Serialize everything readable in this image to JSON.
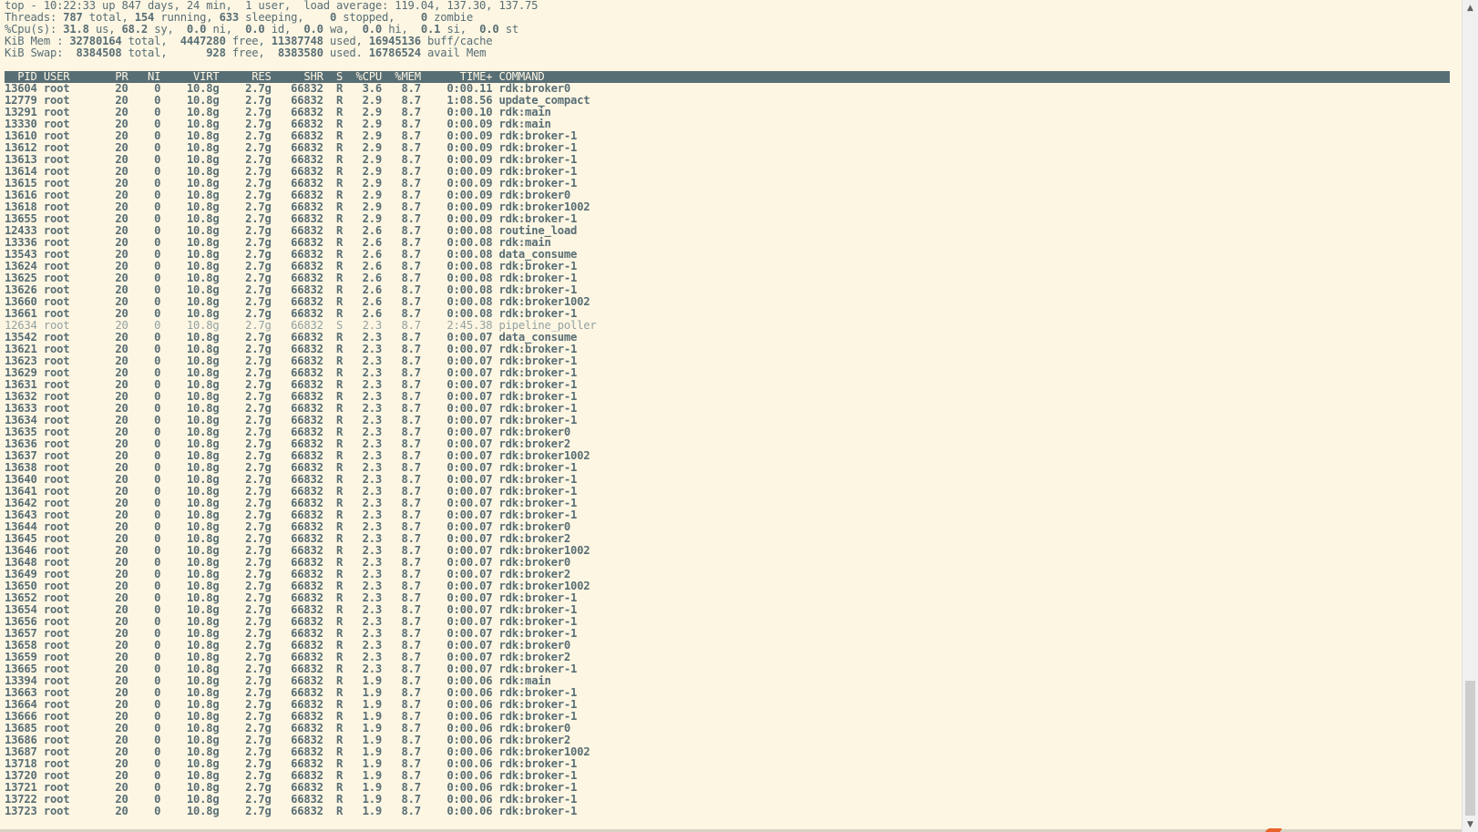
{
  "summary": {
    "line1": "top - 10:22:33 up 847 days, 24 min,  1 user,  load average: 119.04, 137.30, 137.75",
    "threads": {
      "total": "787",
      "running": "154",
      "sleeping": "633",
      "stopped": "0",
      "zombie": "0"
    },
    "cpu": {
      "us": "31.8",
      "sy": "68.2",
      "ni": "0.0",
      "id": "0.0",
      "wa": "0.0",
      "hi": "0.0",
      "si": "0.1",
      "st": "0.0"
    },
    "mem": {
      "total": "32780164",
      "free": "4447280",
      "used": "11387748",
      "buff": "16945136"
    },
    "swap": {
      "total": "8384508",
      "free": "928",
      "used": "8383580",
      "avail": "16786524"
    }
  },
  "labels": {
    "threads": "Threads:",
    "cpu": "%Cpu(s):",
    "mem": "KiB Mem :",
    "swap": "KiB Swap:"
  },
  "columns": [
    "PID",
    "USER",
    "PR",
    "NI",
    "VIRT",
    "RES",
    "SHR",
    "S",
    "%CPU",
    "%MEM",
    "TIME+",
    "COMMAND"
  ],
  "processes": [
    [
      "13604",
      "root",
      "20",
      "0",
      "10.8g",
      "2.7g",
      "66832",
      "R",
      "3.6",
      "8.7",
      "0:00.11",
      "rdk:broker0"
    ],
    [
      "12779",
      "root",
      "20",
      "0",
      "10.8g",
      "2.7g",
      "66832",
      "R",
      "2.9",
      "8.7",
      "1:08.56",
      "update_compact"
    ],
    [
      "13291",
      "root",
      "20",
      "0",
      "10.8g",
      "2.7g",
      "66832",
      "R",
      "2.9",
      "8.7",
      "0:00.10",
      "rdk:main"
    ],
    [
      "13330",
      "root",
      "20",
      "0",
      "10.8g",
      "2.7g",
      "66832",
      "R",
      "2.9",
      "8.7",
      "0:00.09",
      "rdk:main"
    ],
    [
      "13610",
      "root",
      "20",
      "0",
      "10.8g",
      "2.7g",
      "66832",
      "R",
      "2.9",
      "8.7",
      "0:00.09",
      "rdk:broker-1"
    ],
    [
      "13612",
      "root",
      "20",
      "0",
      "10.8g",
      "2.7g",
      "66832",
      "R",
      "2.9",
      "8.7",
      "0:00.09",
      "rdk:broker-1"
    ],
    [
      "13613",
      "root",
      "20",
      "0",
      "10.8g",
      "2.7g",
      "66832",
      "R",
      "2.9",
      "8.7",
      "0:00.09",
      "rdk:broker-1"
    ],
    [
      "13614",
      "root",
      "20",
      "0",
      "10.8g",
      "2.7g",
      "66832",
      "R",
      "2.9",
      "8.7",
      "0:00.09",
      "rdk:broker-1"
    ],
    [
      "13615",
      "root",
      "20",
      "0",
      "10.8g",
      "2.7g",
      "66832",
      "R",
      "2.9",
      "8.7",
      "0:00.09",
      "rdk:broker-1"
    ],
    [
      "13616",
      "root",
      "20",
      "0",
      "10.8g",
      "2.7g",
      "66832",
      "R",
      "2.9",
      "8.7",
      "0:00.09",
      "rdk:broker0"
    ],
    [
      "13618",
      "root",
      "20",
      "0",
      "10.8g",
      "2.7g",
      "66832",
      "R",
      "2.9",
      "8.7",
      "0:00.09",
      "rdk:broker1002"
    ],
    [
      "13655",
      "root",
      "20",
      "0",
      "10.8g",
      "2.7g",
      "66832",
      "R",
      "2.9",
      "8.7",
      "0:00.09",
      "rdk:broker-1"
    ],
    [
      "12433",
      "root",
      "20",
      "0",
      "10.8g",
      "2.7g",
      "66832",
      "R",
      "2.6",
      "8.7",
      "0:00.08",
      "routine_load"
    ],
    [
      "13336",
      "root",
      "20",
      "0",
      "10.8g",
      "2.7g",
      "66832",
      "R",
      "2.6",
      "8.7",
      "0:00.08",
      "rdk:main"
    ],
    [
      "13543",
      "root",
      "20",
      "0",
      "10.8g",
      "2.7g",
      "66832",
      "R",
      "2.6",
      "8.7",
      "0:00.08",
      "data_consume"
    ],
    [
      "13624",
      "root",
      "20",
      "0",
      "10.8g",
      "2.7g",
      "66832",
      "R",
      "2.6",
      "8.7",
      "0:00.08",
      "rdk:broker-1"
    ],
    [
      "13625",
      "root",
      "20",
      "0",
      "10.8g",
      "2.7g",
      "66832",
      "R",
      "2.6",
      "8.7",
      "0:00.08",
      "rdk:broker-1"
    ],
    [
      "13626",
      "root",
      "20",
      "0",
      "10.8g",
      "2.7g",
      "66832",
      "R",
      "2.6",
      "8.7",
      "0:00.08",
      "rdk:broker-1"
    ],
    [
      "13660",
      "root",
      "20",
      "0",
      "10.8g",
      "2.7g",
      "66832",
      "R",
      "2.6",
      "8.7",
      "0:00.08",
      "rdk:broker1002"
    ],
    [
      "13661",
      "root",
      "20",
      "0",
      "10.8g",
      "2.7g",
      "66832",
      "R",
      "2.6",
      "8.7",
      "0:00.08",
      "rdk:broker-1"
    ],
    [
      "12634",
      "root",
      "20",
      "0",
      "10.8g",
      "2.7g",
      "66832",
      "S",
      "2.3",
      "8.7",
      "2:45.38",
      "pipeline_poller"
    ],
    [
      "13542",
      "root",
      "20",
      "0",
      "10.8g",
      "2.7g",
      "66832",
      "R",
      "2.3",
      "8.7",
      "0:00.07",
      "data_consume"
    ],
    [
      "13621",
      "root",
      "20",
      "0",
      "10.8g",
      "2.7g",
      "66832",
      "R",
      "2.3",
      "8.7",
      "0:00.07",
      "rdk:broker-1"
    ],
    [
      "13623",
      "root",
      "20",
      "0",
      "10.8g",
      "2.7g",
      "66832",
      "R",
      "2.3",
      "8.7",
      "0:00.07",
      "rdk:broker-1"
    ],
    [
      "13629",
      "root",
      "20",
      "0",
      "10.8g",
      "2.7g",
      "66832",
      "R",
      "2.3",
      "8.7",
      "0:00.07",
      "rdk:broker-1"
    ],
    [
      "13631",
      "root",
      "20",
      "0",
      "10.8g",
      "2.7g",
      "66832",
      "R",
      "2.3",
      "8.7",
      "0:00.07",
      "rdk:broker-1"
    ],
    [
      "13632",
      "root",
      "20",
      "0",
      "10.8g",
      "2.7g",
      "66832",
      "R",
      "2.3",
      "8.7",
      "0:00.07",
      "rdk:broker-1"
    ],
    [
      "13633",
      "root",
      "20",
      "0",
      "10.8g",
      "2.7g",
      "66832",
      "R",
      "2.3",
      "8.7",
      "0:00.07",
      "rdk:broker-1"
    ],
    [
      "13634",
      "root",
      "20",
      "0",
      "10.8g",
      "2.7g",
      "66832",
      "R",
      "2.3",
      "8.7",
      "0:00.07",
      "rdk:broker-1"
    ],
    [
      "13635",
      "root",
      "20",
      "0",
      "10.8g",
      "2.7g",
      "66832",
      "R",
      "2.3",
      "8.7",
      "0:00.07",
      "rdk:broker0"
    ],
    [
      "13636",
      "root",
      "20",
      "0",
      "10.8g",
      "2.7g",
      "66832",
      "R",
      "2.3",
      "8.7",
      "0:00.07",
      "rdk:broker2"
    ],
    [
      "13637",
      "root",
      "20",
      "0",
      "10.8g",
      "2.7g",
      "66832",
      "R",
      "2.3",
      "8.7",
      "0:00.07",
      "rdk:broker1002"
    ],
    [
      "13638",
      "root",
      "20",
      "0",
      "10.8g",
      "2.7g",
      "66832",
      "R",
      "2.3",
      "8.7",
      "0:00.07",
      "rdk:broker-1"
    ],
    [
      "13640",
      "root",
      "20",
      "0",
      "10.8g",
      "2.7g",
      "66832",
      "R",
      "2.3",
      "8.7",
      "0:00.07",
      "rdk:broker-1"
    ],
    [
      "13641",
      "root",
      "20",
      "0",
      "10.8g",
      "2.7g",
      "66832",
      "R",
      "2.3",
      "8.7",
      "0:00.07",
      "rdk:broker-1"
    ],
    [
      "13642",
      "root",
      "20",
      "0",
      "10.8g",
      "2.7g",
      "66832",
      "R",
      "2.3",
      "8.7",
      "0:00.07",
      "rdk:broker-1"
    ],
    [
      "13643",
      "root",
      "20",
      "0",
      "10.8g",
      "2.7g",
      "66832",
      "R",
      "2.3",
      "8.7",
      "0:00.07",
      "rdk:broker-1"
    ],
    [
      "13644",
      "root",
      "20",
      "0",
      "10.8g",
      "2.7g",
      "66832",
      "R",
      "2.3",
      "8.7",
      "0:00.07",
      "rdk:broker0"
    ],
    [
      "13645",
      "root",
      "20",
      "0",
      "10.8g",
      "2.7g",
      "66832",
      "R",
      "2.3",
      "8.7",
      "0:00.07",
      "rdk:broker2"
    ],
    [
      "13646",
      "root",
      "20",
      "0",
      "10.8g",
      "2.7g",
      "66832",
      "R",
      "2.3",
      "8.7",
      "0:00.07",
      "rdk:broker1002"
    ],
    [
      "13648",
      "root",
      "20",
      "0",
      "10.8g",
      "2.7g",
      "66832",
      "R",
      "2.3",
      "8.7",
      "0:00.07",
      "rdk:broker0"
    ],
    [
      "13649",
      "root",
      "20",
      "0",
      "10.8g",
      "2.7g",
      "66832",
      "R",
      "2.3",
      "8.7",
      "0:00.07",
      "rdk:broker2"
    ],
    [
      "13650",
      "root",
      "20",
      "0",
      "10.8g",
      "2.7g",
      "66832",
      "R",
      "2.3",
      "8.7",
      "0:00.07",
      "rdk:broker1002"
    ],
    [
      "13652",
      "root",
      "20",
      "0",
      "10.8g",
      "2.7g",
      "66832",
      "R",
      "2.3",
      "8.7",
      "0:00.07",
      "rdk:broker-1"
    ],
    [
      "13654",
      "root",
      "20",
      "0",
      "10.8g",
      "2.7g",
      "66832",
      "R",
      "2.3",
      "8.7",
      "0:00.07",
      "rdk:broker-1"
    ],
    [
      "13656",
      "root",
      "20",
      "0",
      "10.8g",
      "2.7g",
      "66832",
      "R",
      "2.3",
      "8.7",
      "0:00.07",
      "rdk:broker-1"
    ],
    [
      "13657",
      "root",
      "20",
      "0",
      "10.8g",
      "2.7g",
      "66832",
      "R",
      "2.3",
      "8.7",
      "0:00.07",
      "rdk:broker-1"
    ],
    [
      "13658",
      "root",
      "20",
      "0",
      "10.8g",
      "2.7g",
      "66832",
      "R",
      "2.3",
      "8.7",
      "0:00.07",
      "rdk:broker0"
    ],
    [
      "13659",
      "root",
      "20",
      "0",
      "10.8g",
      "2.7g",
      "66832",
      "R",
      "2.3",
      "8.7",
      "0:00.07",
      "rdk:broker2"
    ],
    [
      "13665",
      "root",
      "20",
      "0",
      "10.8g",
      "2.7g",
      "66832",
      "R",
      "2.3",
      "8.7",
      "0:00.07",
      "rdk:broker-1"
    ],
    [
      "13394",
      "root",
      "20",
      "0",
      "10.8g",
      "2.7g",
      "66832",
      "R",
      "1.9",
      "8.7",
      "0:00.06",
      "rdk:main"
    ],
    [
      "13663",
      "root",
      "20",
      "0",
      "10.8g",
      "2.7g",
      "66832",
      "R",
      "1.9",
      "8.7",
      "0:00.06",
      "rdk:broker-1"
    ],
    [
      "13664",
      "root",
      "20",
      "0",
      "10.8g",
      "2.7g",
      "66832",
      "R",
      "1.9",
      "8.7",
      "0:00.06",
      "rdk:broker-1"
    ],
    [
      "13666",
      "root",
      "20",
      "0",
      "10.8g",
      "2.7g",
      "66832",
      "R",
      "1.9",
      "8.7",
      "0:00.06",
      "rdk:broker-1"
    ],
    [
      "13685",
      "root",
      "20",
      "0",
      "10.8g",
      "2.7g",
      "66832",
      "R",
      "1.9",
      "8.7",
      "0:00.06",
      "rdk:broker0"
    ],
    [
      "13686",
      "root",
      "20",
      "0",
      "10.8g",
      "2.7g",
      "66832",
      "R",
      "1.9",
      "8.7",
      "0:00.06",
      "rdk:broker2"
    ],
    [
      "13687",
      "root",
      "20",
      "0",
      "10.8g",
      "2.7g",
      "66832",
      "R",
      "1.9",
      "8.7",
      "0:00.06",
      "rdk:broker1002"
    ],
    [
      "13718",
      "root",
      "20",
      "0",
      "10.8g",
      "2.7g",
      "66832",
      "R",
      "1.9",
      "8.7",
      "0:00.06",
      "rdk:broker-1"
    ],
    [
      "13720",
      "root",
      "20",
      "0",
      "10.8g",
      "2.7g",
      "66832",
      "R",
      "1.9",
      "8.7",
      "0:00.06",
      "rdk:broker-1"
    ],
    [
      "13721",
      "root",
      "20",
      "0",
      "10.8g",
      "2.7g",
      "66832",
      "R",
      "1.9",
      "8.7",
      "0:00.06",
      "rdk:broker-1"
    ],
    [
      "13722",
      "root",
      "20",
      "0",
      "10.8g",
      "2.7g",
      "66832",
      "R",
      "1.9",
      "8.7",
      "0:00.06",
      "rdk:broker-1"
    ],
    [
      "13723",
      "root",
      "20",
      "0",
      "10.8g",
      "2.7g",
      "66832",
      "R",
      "1.9",
      "8.7",
      "0:00.06",
      "rdk:broker-1"
    ]
  ],
  "colors": {
    "background": "#fdf6e3",
    "foreground": "#586e75",
    "header_bg": "#586e75",
    "header_fg": "#fdf6e3",
    "sleeping_fg": "#93a1a1"
  },
  "icons": {
    "scroll_up": "chevron-up-icon",
    "scroll_down": "chevron-down-icon"
  }
}
